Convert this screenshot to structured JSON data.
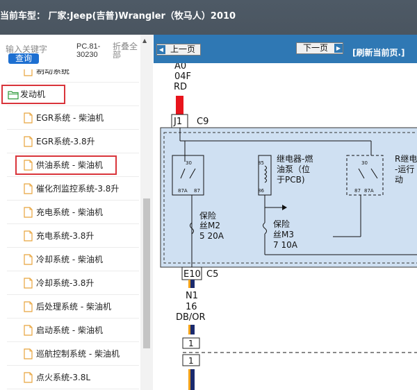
{
  "title": "当前车型： 厂家:Jeep(吉普)Wrangler（牧马人）2010",
  "sidebar": {
    "search_placeholder": "输入关键字",
    "query_button": "查询",
    "code_label": "PC.81-30230",
    "collapse_all": "折叠全部",
    "items": [
      {
        "label": "制动系统",
        "type": "file"
      },
      {
        "label": "发动机",
        "type": "folder"
      },
      {
        "label": "EGR系统 - 柴油机",
        "type": "file"
      },
      {
        "label": "EGR系统-3.8升",
        "type": "file"
      },
      {
        "label": "供油系统 - 柴油机",
        "type": "file"
      },
      {
        "label": "催化剂监控系统-3.8升",
        "type": "file"
      },
      {
        "label": "充电系统 - 柴油机",
        "type": "file"
      },
      {
        "label": "充电系统-3.8升",
        "type": "file"
      },
      {
        "label": "冷却系统 - 柴油机",
        "type": "file"
      },
      {
        "label": "冷却系统-3.8升",
        "type": "file"
      },
      {
        "label": "后处理系统 - 柴油机",
        "type": "file"
      },
      {
        "label": "启动系统 - 柴油机",
        "type": "file"
      },
      {
        "label": "巡航控制系统 - 柴油机",
        "type": "file"
      },
      {
        "label": "点火系统-3.8L",
        "type": "file"
      }
    ]
  },
  "toolbar": {
    "prev_page": "上一页",
    "next_page": "下一页",
    "refresh": "[刷新当前页.]"
  },
  "diagram": {
    "top_wire": [
      "A0",
      "04F",
      "RD"
    ],
    "j1": "J1",
    "c9": "C9",
    "pin30a": "30",
    "pin87a_a": "87A",
    "pin87_a": "87",
    "pin85": "85",
    "pin86": "86",
    "relay_label": [
      "继电器-燃",
      "油泵（位",
      "于PCB)"
    ],
    "pin30b": "30",
    "pin87_b": "87",
    "pin87a_b": "87A",
    "r_label": [
      "R继电",
      "-运行",
      "动"
    ],
    "fuse_m2": [
      "保险",
      "丝M2",
      "5 20A"
    ],
    "fuse_m3": [
      "保险",
      "丝M3",
      "7 10A"
    ],
    "e10": "E10",
    "c5": "C5",
    "bottom_wire": [
      "N1",
      "16",
      "DB/OR"
    ],
    "conn_top": "1",
    "conn_bottom": "1",
    "colors": {
      "red_wire": "#e8141c",
      "navy_wire": "#1a2a6e",
      "wire_orange": "#f2a21b",
      "pcb_fill": "#cfe0f2"
    }
  }
}
